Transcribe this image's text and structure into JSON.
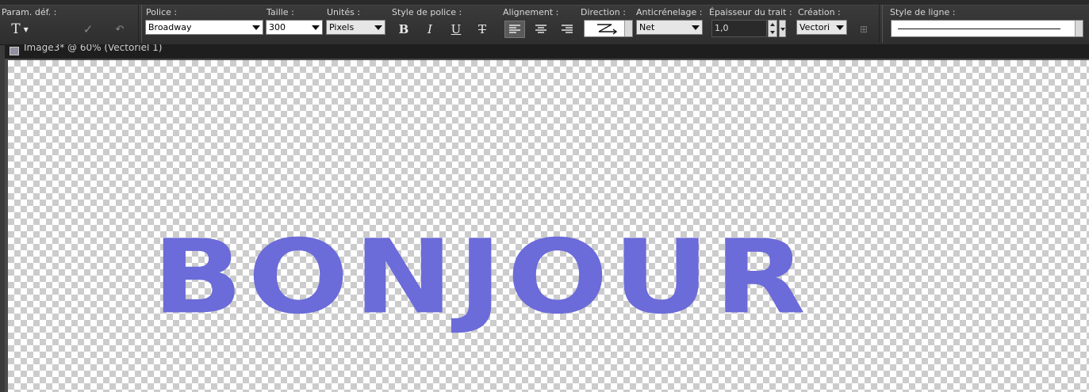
{
  "toolbar": {
    "presets": {
      "label": "Param. déf. :",
      "tool_glyph": "T"
    },
    "font": {
      "label": "Police :",
      "value": "Broadway"
    },
    "size": {
      "label": "Taille :",
      "value": "300"
    },
    "units": {
      "label": "Unités :",
      "value": "Pixels"
    },
    "font_style": {
      "label": "Style de police :",
      "bold": "B",
      "italic": "I",
      "underline": "U",
      "strike": "T"
    },
    "alignment": {
      "label": "Alignement :",
      "selected": "left"
    },
    "direction": {
      "label": "Direction :"
    },
    "antialias": {
      "label": "Anticrénelage :",
      "value": "Net"
    },
    "stroke": {
      "label": "Épaisseur du trait :",
      "value": "1,0"
    },
    "creation": {
      "label": "Création :",
      "value": "Vectori"
    },
    "line_style": {
      "label": "Style de ligne :"
    }
  },
  "document": {
    "title": "Image3* @ 60% (Vectoriel 1)",
    "text": "BONJOUR",
    "text_color": "#6b6bd9"
  }
}
